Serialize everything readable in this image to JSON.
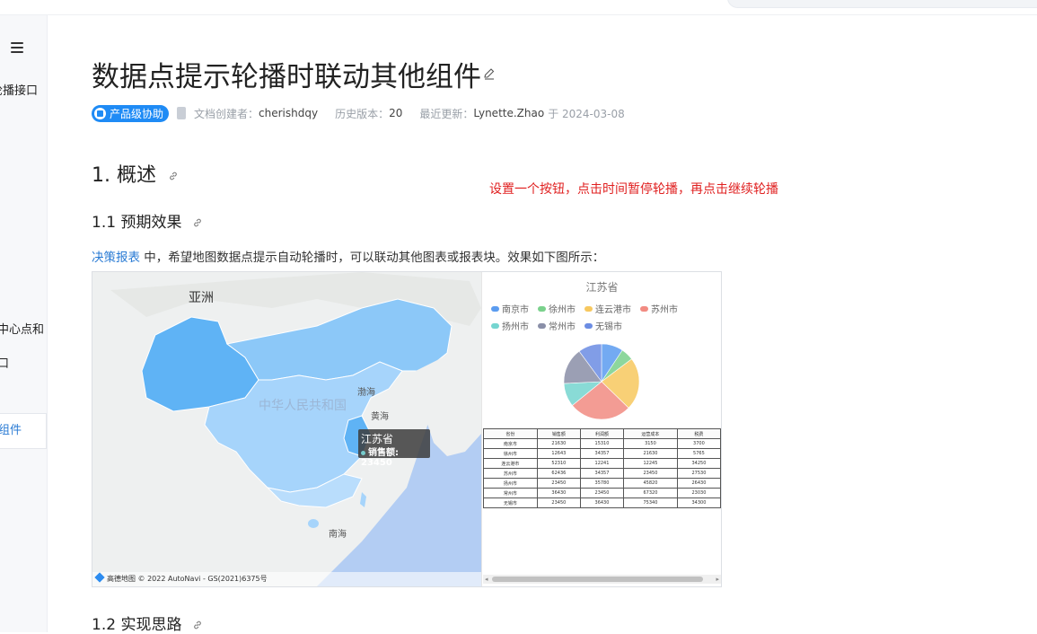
{
  "sidebar": {
    "items": [
      {
        "label": "轮播接口"
      },
      {
        "label": "图中心点和"
      },
      {
        "label": "接口"
      },
      {
        "label": "其他组件"
      }
    ]
  },
  "page": {
    "title": "数据点提示轮播时联动其他组件",
    "badge": "产品级协助",
    "creator_label": "文档创建者：",
    "creator": "cherishdqy",
    "history_label": "历史版本：",
    "history": "20",
    "updated_label": "最近更新：",
    "updated_by": "Lynette.Zhao",
    "updated_on": "于 2024-03-08"
  },
  "content": {
    "h1": "1. 概述",
    "h2_effect": "1.1 预期效果",
    "annotation": "设置一个按钮，点击时间暂停轮播，再点击继续轮播",
    "para_link": "决策报表",
    "para_text": " 中，希望地图数据点提示自动轮播时，可以联动其他图表或报表块。效果如下图所示：",
    "h2_idea": "1.2 实现思路"
  },
  "figure": {
    "map": {
      "asia": "亚洲",
      "china": "中华人民共和国",
      "bohai": "渤海",
      "yellow_sea": "黄海",
      "south_sea": "南海",
      "tooltip_title": "江苏省",
      "tooltip_value": "销售额: 23450",
      "footer": "高德地图 © 2022 AutoNavi - GS(2021)6375号"
    },
    "chart": {
      "title": "江苏省",
      "legend": [
        "南京市",
        "徐州市",
        "连云港市",
        "苏州市",
        "扬州市",
        "常州市",
        "无锡市"
      ],
      "colors": [
        "#5b9cf0",
        "#7ad18c",
        "#f7c85f",
        "#f28b82",
        "#75d5d0",
        "#8a8fa8",
        "#6c8de3"
      ]
    },
    "table": {
      "headers": [
        "省份",
        "销售额",
        "利润额",
        "运营成本",
        "税费"
      ],
      "rows": [
        [
          "南京市",
          "21630",
          "15310",
          "3150",
          "3700"
        ],
        [
          "徐州市",
          "12643",
          "34357",
          "21630",
          "5765"
        ],
        [
          "连云港市",
          "52310",
          "12241",
          "12245",
          "34250"
        ],
        [
          "苏州市",
          "62436",
          "34357",
          "23450",
          "27530"
        ],
        [
          "扬州市",
          "23450",
          "35780",
          "45820",
          "26430"
        ],
        [
          "常州市",
          "36430",
          "23450",
          "67320",
          "23030"
        ],
        [
          "无锡市",
          "23450",
          "36430",
          "75340",
          "34300"
        ]
      ]
    }
  }
}
